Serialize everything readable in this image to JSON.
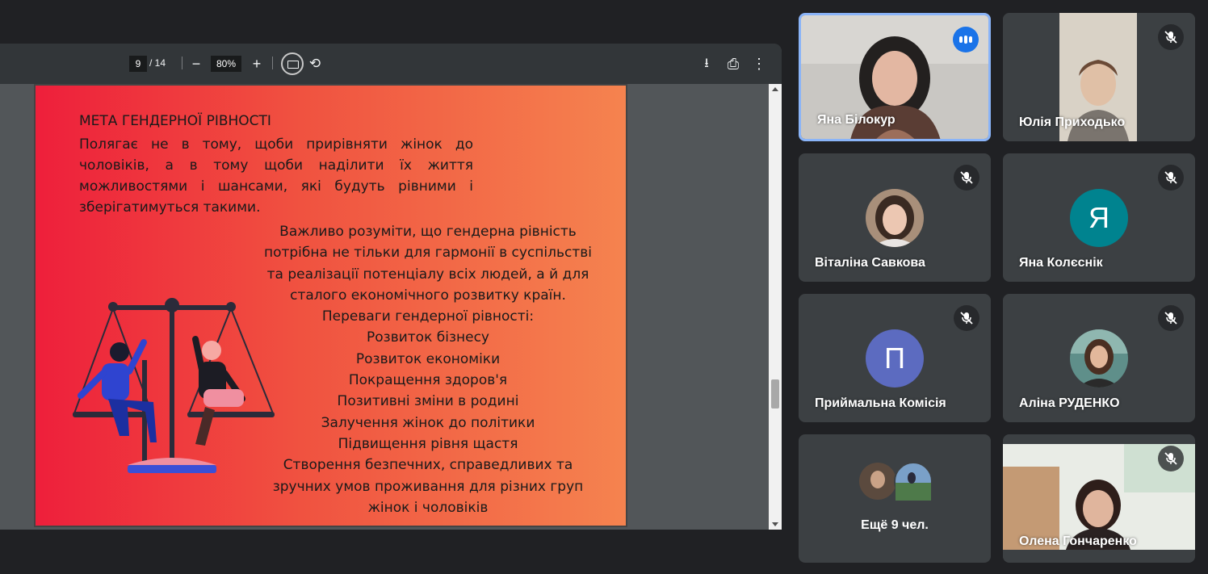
{
  "pdf_viewer": {
    "page_current": "9",
    "page_total": "/ 14",
    "zoom": "80%",
    "zoom_out": "−",
    "zoom_in": "+",
    "download_icon": "⭳",
    "print_icon": "⎙",
    "more_icon": "⋮",
    "rotate_icon": "⟲"
  },
  "slide": {
    "title": "МЕТА ГЕНДЕРНОЇ РІВНОСТІ",
    "paragraph": "Полягає не в тому, щоби прирівняти жінок до чоловіків, а в тому щоби наділити їх життя можливостями і шансами, які будуть рівними і зберігатимуться такими.",
    "block_lines": [
      "Важливо розуміти, що гендерна рівність",
      "потрібна не тільки для гармонії в суспільстві",
      "та реалізації потенціалу всіх людей, а й для",
      "сталого економічного розвитку країн.",
      "Переваги гендерної рівності:",
      "Розвиток бізнесу",
      "Розвиток економіки",
      "Покращення здоров'я",
      "Позитивні зміни в родині",
      "Залучення жінок до політики",
      "Підвищення рівня щастя",
      "Створення безпечних, справедливих та",
      "зручних умов проживання для різних груп",
      "жінок і чоловіків"
    ]
  },
  "participants": [
    {
      "name": "Яна Білокур",
      "speaking": true
    },
    {
      "name": "Юлія Приходько",
      "muted": true
    },
    {
      "name": "Віталіна Савкова",
      "muted": true
    },
    {
      "name": "Яна Колєснік",
      "muted": true,
      "initial": "Я",
      "color": "#00838f"
    },
    {
      "name": "Приймальна Комісія",
      "muted": true,
      "initial": "П",
      "color": "#5c6bc0"
    },
    {
      "name": "Аліна РУДЕНКО",
      "muted": true
    },
    {
      "name": "Ещё 9 чел."
    },
    {
      "name": "Олена Гончаренко",
      "muted": true
    }
  ],
  "colors": {
    "speaking_accent": "#1a73e8",
    "tile_bg": "#3c4043",
    "slide_gradient_start": "#ee1f3b",
    "slide_gradient_end": "#f5834f"
  }
}
